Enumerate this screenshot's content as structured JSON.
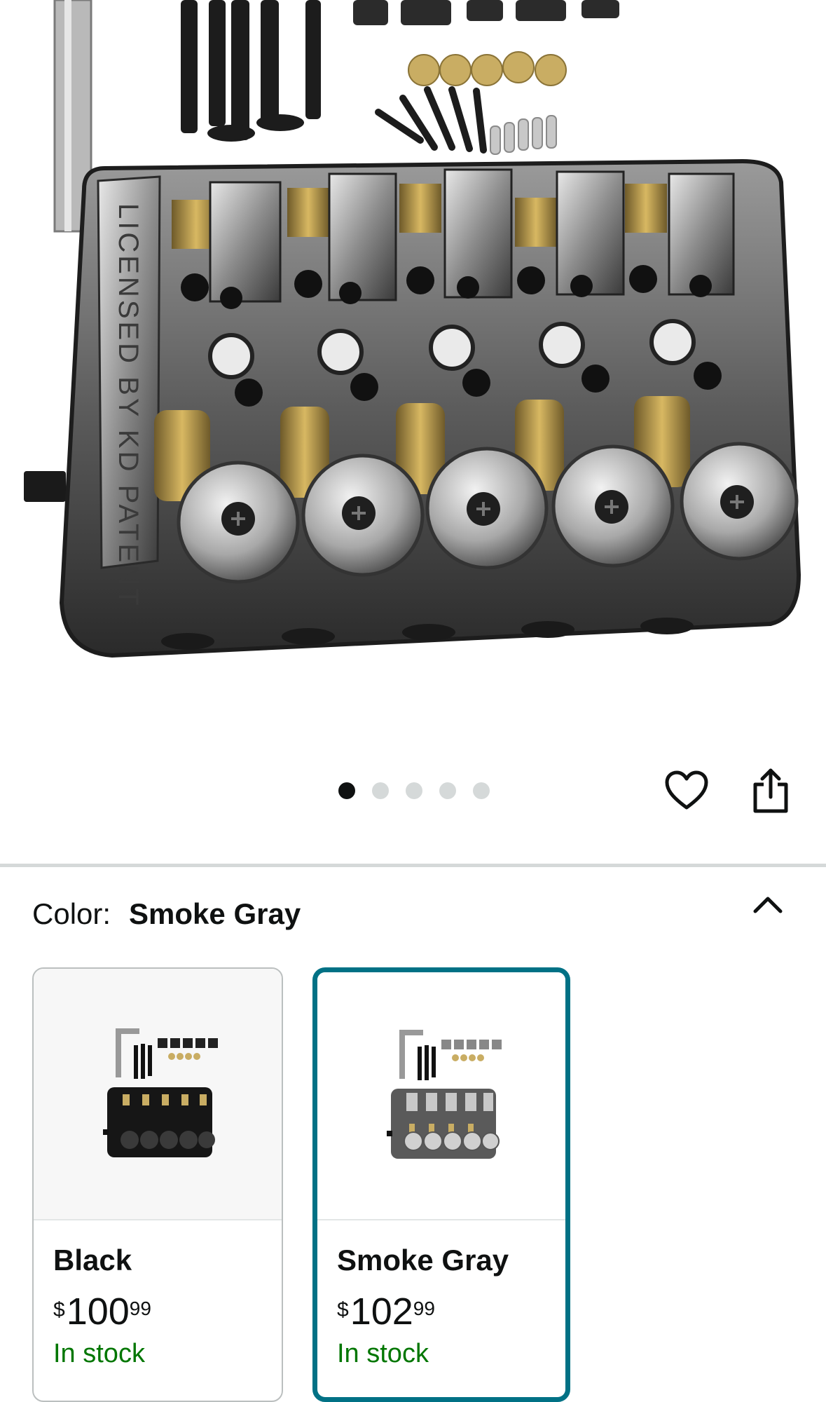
{
  "product": {
    "image_alt": "Guitar bridge with saddles, screws and pins"
  },
  "carousel": {
    "total_images": 5,
    "active_index": 0
  },
  "actions": {
    "wishlist_icon": "heart-icon",
    "share_icon": "share-icon"
  },
  "variation": {
    "label": "Color:",
    "selected_value": "Smoke Gray",
    "toggle_icon": "chevron-up-icon",
    "options": [
      {
        "name": "Black",
        "currency": "$",
        "price_whole": "100",
        "price_fraction": "99",
        "availability": "In stock",
        "selected": false
      },
      {
        "name": "Smoke Gray",
        "currency": "$",
        "price_whole": "102",
        "price_fraction": "99",
        "availability": "In stock",
        "selected": true
      }
    ]
  },
  "colors": {
    "accent_selected_border": "#007185",
    "in_stock_green": "#007600",
    "dot_active": "#0f1111",
    "dot_inactive": "#d5d9d9"
  }
}
